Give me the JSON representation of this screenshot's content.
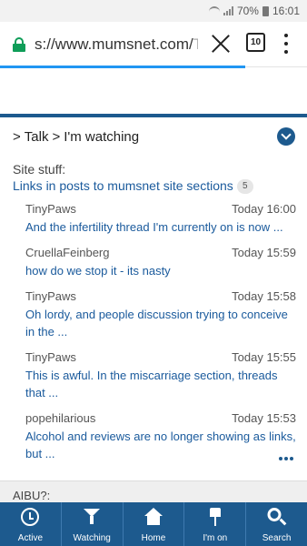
{
  "status_bar": {
    "battery": "70%",
    "time": "16:01"
  },
  "browser": {
    "url_visible": "s://www.mumsnet.com/",
    "url_faded": "Ta",
    "tab_count": "10",
    "progress_fraction": 0.8
  },
  "breadcrumb": {
    "sep1": ">",
    "talk": "Talk",
    "sep2": ">",
    "current": "I'm watching"
  },
  "section": {
    "label": "Site stuff:",
    "link": "Links in posts to mumsnet site sections",
    "count": "5"
  },
  "threads": [
    {
      "author": "TinyPaws",
      "time": "Today 16:00",
      "title": "And the infertility thread I'm currently on is now ..."
    },
    {
      "author": "CruellaFeinberg",
      "time": "Today 15:59",
      "title": "how do we stop it - its nasty"
    },
    {
      "author": "TinyPaws",
      "time": "Today 15:58",
      "title": "Oh lordy, and people discussion trying to conceive in the ..."
    },
    {
      "author": "TinyPaws",
      "time": "Today 15:55",
      "title": "This is awful. In the miscarriage section, threads that ..."
    },
    {
      "author": "popehilarious",
      "time": "Today 15:53",
      "title": "Alcohol and reviews are no longer showing as links, but ..."
    }
  ],
  "section2": {
    "label": "AIBU?:"
  },
  "bottom_nav": [
    {
      "label": "Active",
      "icon": "clock-icon"
    },
    {
      "label": "Watching",
      "icon": "filter-icon"
    },
    {
      "label": "Home",
      "icon": "home-icon"
    },
    {
      "label": "I'm on",
      "icon": "pin-icon"
    },
    {
      "label": "Search",
      "icon": "search-icon"
    }
  ],
  "colors": {
    "brand_blue": "#1d5a8e",
    "link_blue": "#1a5a9c",
    "lock_green": "#0f9d58",
    "progress_blue": "#2196f3"
  }
}
